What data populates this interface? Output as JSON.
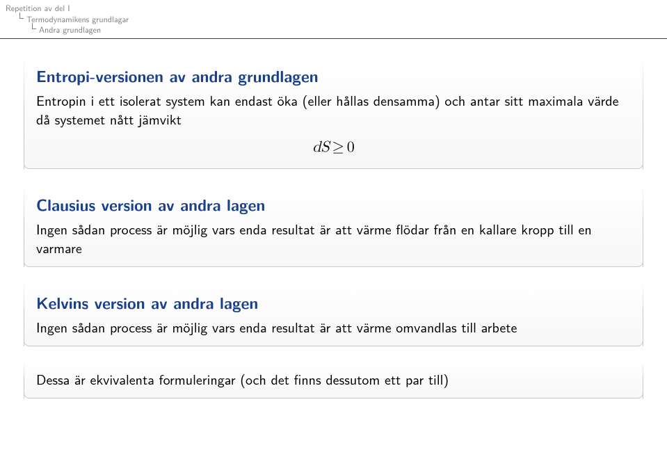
{
  "breadcrumbs": {
    "level1": "Repetition av del I",
    "level2": "Termodynamikens grundlagar",
    "level3": "Andra grundlagen"
  },
  "blocks": {
    "entropy": {
      "title": "Entropi-versionen av andra grundlagen",
      "body": "Entropin i ett isolerat system kan endast öka (eller hållas densamma) och antar sitt maximala värde då systemet nått jämvikt",
      "formula_lhs": "dS",
      "formula_op": "≥",
      "formula_rhs": "0"
    },
    "clausius": {
      "title": "Clausius version av andra lagen",
      "body": "Ingen sådan process är möjlig vars enda resultat är att värme flödar från en kallare kropp till en varmare"
    },
    "kelvin": {
      "title": "Kelvins version av andra lagen",
      "body": "Ingen sådan process är möjlig vars enda resultat är att värme omvandlas till arbete"
    },
    "equiv": {
      "body": "Dessa är ekvivalenta formuleringar (och det finns dessutom ett par till)"
    }
  }
}
